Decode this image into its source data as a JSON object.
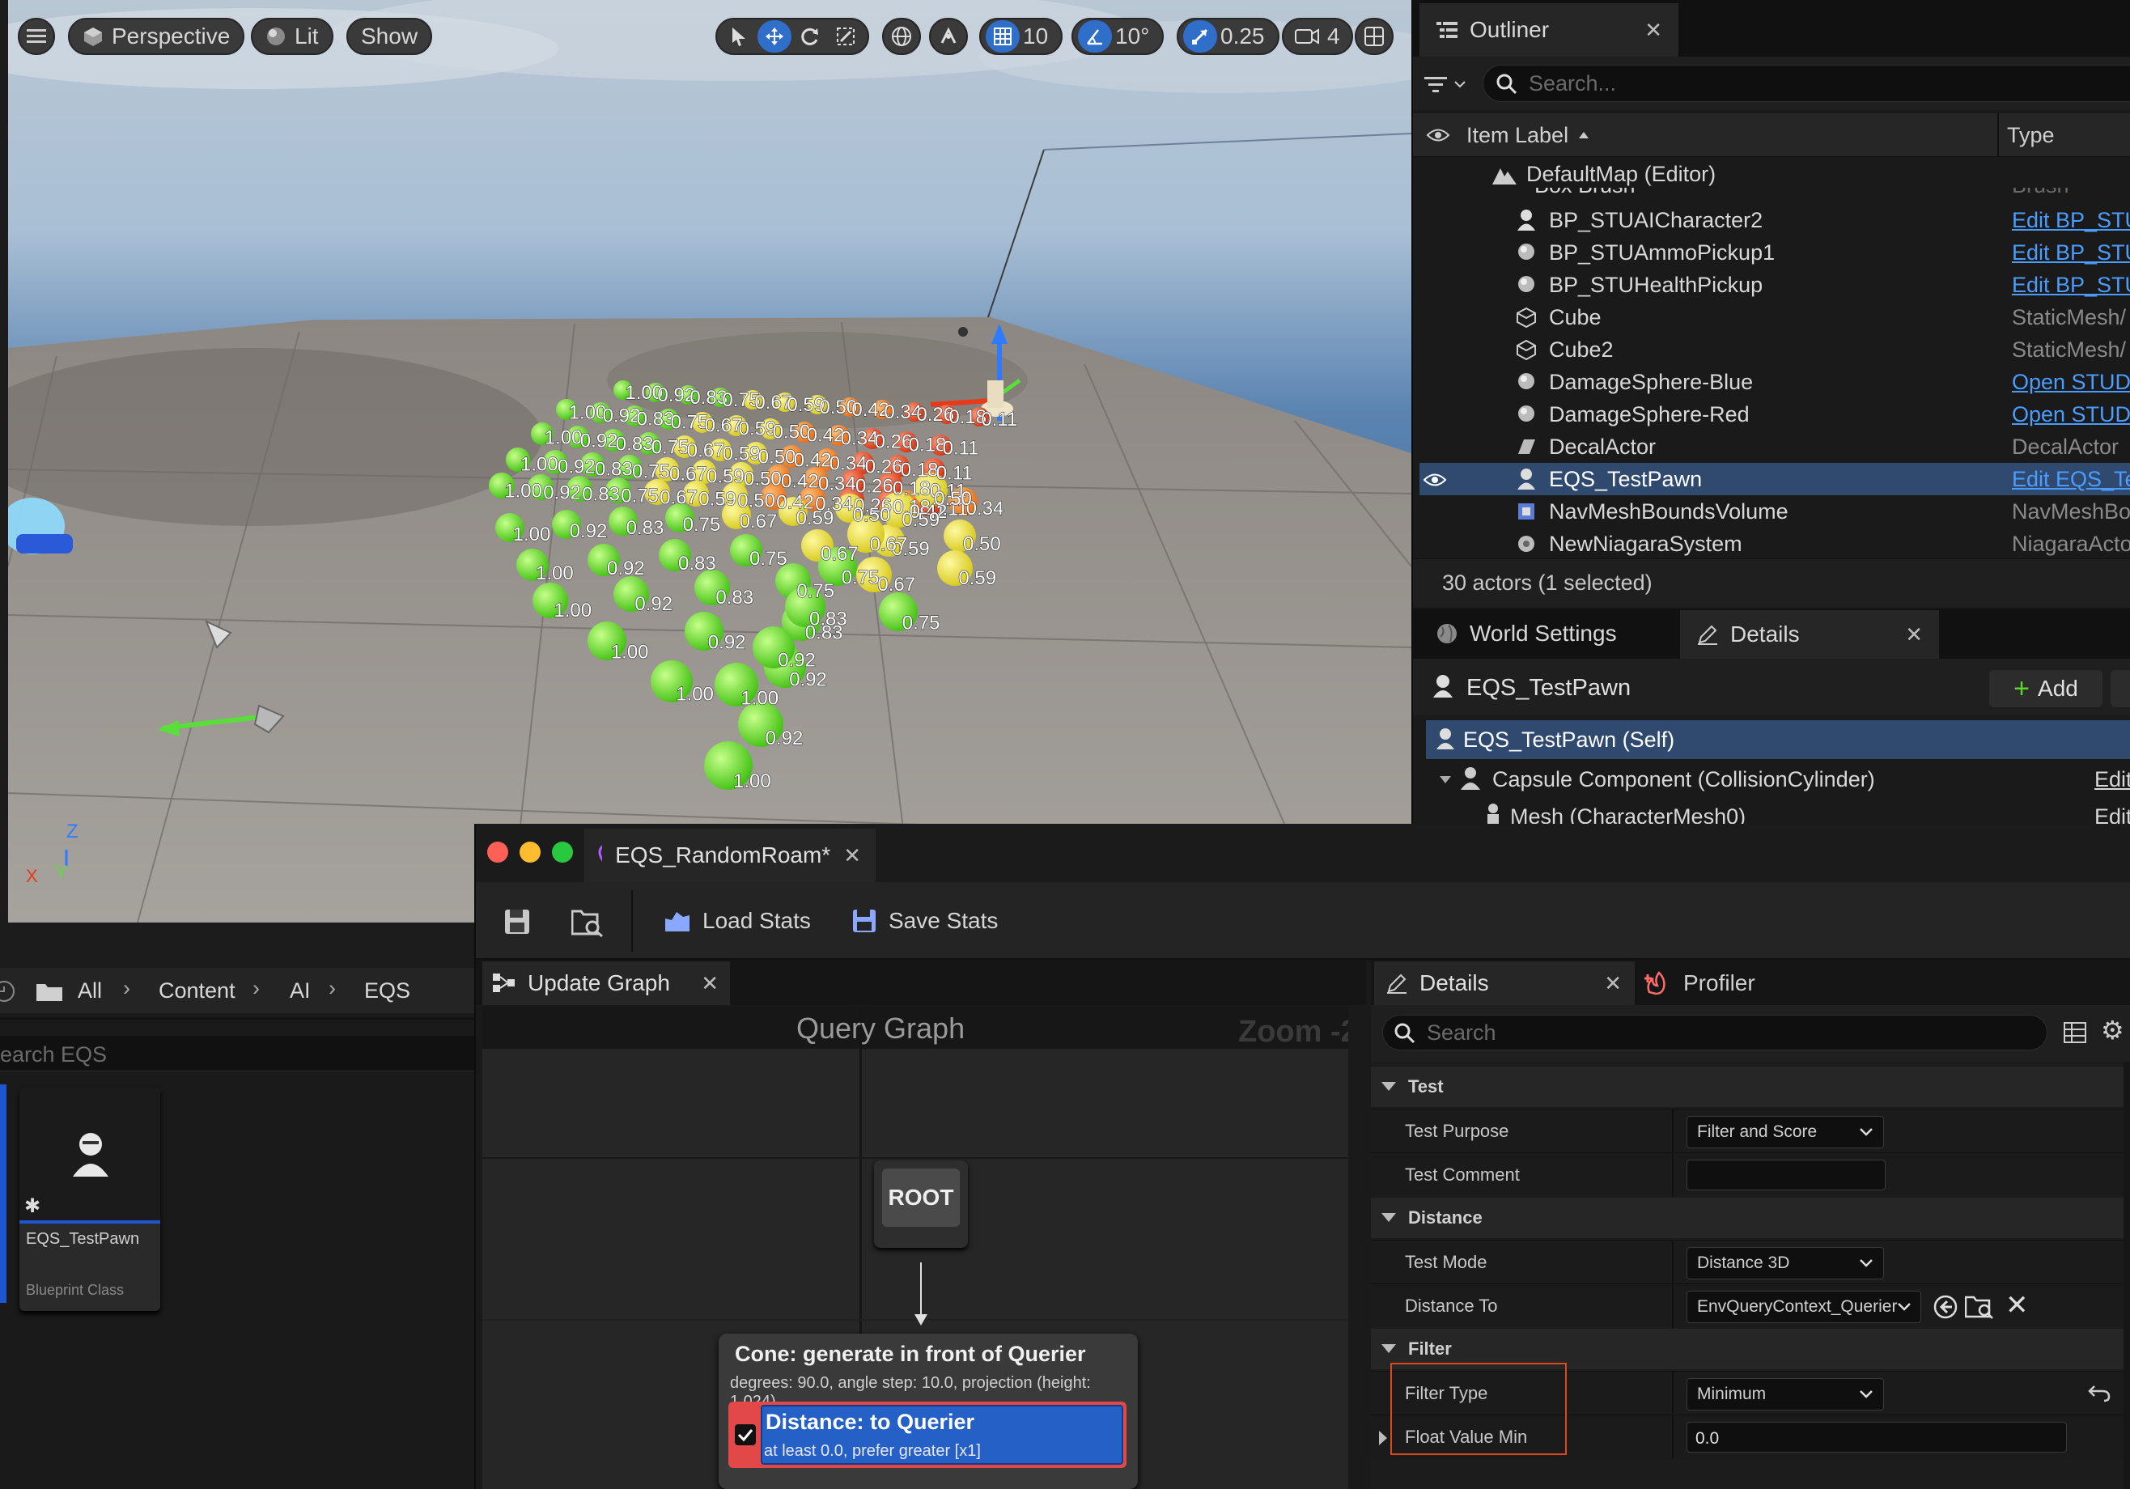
{
  "viewport": {
    "menu_icon": "hamburger-icon",
    "perspective_label": "Perspective",
    "lit_label": "Lit",
    "show_label": "Show",
    "grid_value": "10",
    "angle_value": "10°",
    "scale_value": "0.25",
    "camera_speed": "4",
    "axis_labels": {
      "z": "Z",
      "x": "X",
      "y": "Y"
    },
    "sphere_labels": {
      "row1": [
        "1.00",
        "0.92",
        "0.83",
        "0.75",
        "0.67",
        "0.59",
        "0.50",
        "0.42",
        "0.34"
      ],
      "row2": [
        "1.00",
        "0.92",
        "0.83",
        "0.75",
        "0.67",
        "0.59",
        "0.50"
      ],
      "row3": [
        "1.00",
        "0.92",
        "0.83",
        "0.75",
        "0.67",
        "0.59"
      ],
      "row4": [
        "1.00",
        "0.92",
        "0.83",
        "0.75"
      ],
      "row5": [
        "1.00",
        "0.92"
      ],
      "back_rows": [
        "1.00",
        "0.92",
        "0.83",
        "0.75",
        "0.67",
        "0.59",
        "0.50",
        "0.42",
        "0.34",
        "0.26",
        "0.18",
        "0.11"
      ]
    },
    "accent_colors": {
      "green": "#5ad62a",
      "yellow": "#e8e032",
      "orange": "#f08020",
      "red": "#e83a1a"
    }
  },
  "outliner": {
    "tab_title": "Outliner",
    "search_placeholder": "Search...",
    "col_label": "Item Label",
    "col_type": "Type",
    "root": "DefaultMap (Editor)",
    "partial_row": {
      "label": "Box Brush",
      "type": "Brush"
    },
    "items": [
      {
        "label": "BP_STUAICharacter2",
        "type": "Edit BP_STU",
        "link": true,
        "icon": "pawn-icon"
      },
      {
        "label": "BP_STUAmmoPickup1",
        "type": "Edit BP_STU",
        "link": true,
        "icon": "actor-icon"
      },
      {
        "label": "BP_STUHealthPickup",
        "type": "Edit BP_STU",
        "link": true,
        "icon": "actor-icon"
      },
      {
        "label": "Cube",
        "type": "StaticMesh/",
        "link": false,
        "icon": "cube-icon"
      },
      {
        "label": "Cube2",
        "type": "StaticMesh/",
        "link": false,
        "icon": "cube-icon"
      },
      {
        "label": "DamageSphere-Blue",
        "type": "Open STUD",
        "link": true,
        "icon": "actor-icon"
      },
      {
        "label": "DamageSphere-Red",
        "type": "Open STUD",
        "link": true,
        "icon": "actor-icon"
      },
      {
        "label": "DecalActor",
        "type": "DecalActor",
        "link": false,
        "icon": "decal-icon"
      },
      {
        "label": "EQS_TestPawn",
        "type": "Edit EQS_Te",
        "link": true,
        "icon": "pawn-icon",
        "selected": true
      },
      {
        "label": "NavMeshBoundsVolume",
        "type": "NavMeshBo",
        "link": false,
        "icon": "volume-icon"
      },
      {
        "label": "NewNiagaraSystem",
        "type": "NiagaraActo",
        "link": false,
        "icon": "niagara-icon"
      }
    ],
    "status": "30 actors (1 selected)"
  },
  "lower_right": {
    "tab_world": "World Settings",
    "tab_details": "Details",
    "actor_name": "EQS_TestPawn",
    "add_label": "Add",
    "components": [
      {
        "label": "EQS_TestPawn (Self)",
        "selected": true
      },
      {
        "label": "Capsule Component (CollisionCylinder)",
        "action": "Edit"
      },
      {
        "label": "Mesh (CharacterMesh0)",
        "action": "Edit"
      }
    ]
  },
  "eqs": {
    "title": "EQS_RandomRoam*",
    "load_stats": "Load Stats",
    "save_stats": "Save Stats",
    "graph_tab": "Update Graph",
    "graph_title": "Query Graph",
    "zoom": "Zoom -2",
    "root_label": "ROOT",
    "generator_title": "Cone: generate in front of Querier",
    "generator_sub": "degrees: 90.0, angle step: 10.0, projection (height: 1,024)",
    "test_title": "Distance: to Querier",
    "test_sub": "at least 0.0, prefer greater [x1]"
  },
  "details": {
    "tab_details": "Details",
    "tab_profiler": "Profiler",
    "search_placeholder": "Search",
    "sections": {
      "test": "Test",
      "distance": "Distance",
      "filter": "Filter"
    },
    "rows": {
      "test_purpose": {
        "name": "Test Purpose",
        "value": "Filter and Score"
      },
      "test_comment": {
        "name": "Test Comment",
        "value": ""
      },
      "test_mode": {
        "name": "Test Mode",
        "value": "Distance 3D"
      },
      "distance_to": {
        "name": "Distance To",
        "value": "EnvQueryContext_Querier"
      },
      "filter_type": {
        "name": "Filter Type",
        "value": "Minimum"
      },
      "float_min": {
        "name": "Float Value Min",
        "value": "0.0"
      }
    }
  },
  "content_browser": {
    "breadcrumb": [
      "All",
      "Content",
      "AI",
      "EQS"
    ],
    "search_placeholder": "earch EQS",
    "asset_name": "EQS_TestPawn",
    "asset_type": "Blueprint Class"
  }
}
